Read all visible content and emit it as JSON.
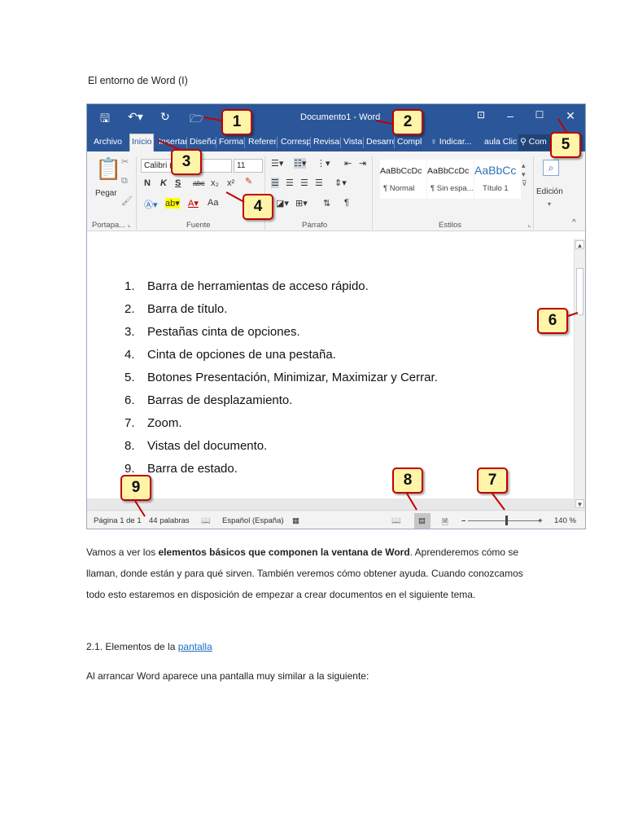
{
  "doc_heading": "El entorno de Word (I)",
  "word": {
    "title": "Documento1 - Word",
    "tabs": [
      "Archivo",
      "Inicio",
      "Insertar",
      "Diseño",
      "Format",
      "Referer",
      "Corresp",
      "Revisar",
      "Vista",
      "Desarro",
      "Compl"
    ],
    "tell_me": "Indicar...",
    "account_text": "aula Clic",
    "share_text": "Com",
    "ribbon": {
      "paste_label": "Pegar",
      "font_name": "Calibri (",
      "font_size": "11",
      "bold": "N",
      "italic": "K",
      "underline": "S",
      "strike": "abc",
      "sub": "x₂",
      "sup": "x²",
      "case": "Aa",
      "pilcrow": "¶",
      "styles": [
        {
          "sample": "AaBbCcDc",
          "name": "¶ Normal"
        },
        {
          "sample": "AaBbCcDc",
          "name": "¶ Sin espa..."
        },
        {
          "sample": "AaBbCc",
          "name": "Título 1"
        }
      ],
      "edit_label": "Edición",
      "groups": [
        "Portapa...",
        "Fuente",
        "Párrafo",
        "Estilos"
      ]
    },
    "list_items": [
      {
        "num": "1.",
        "text": "Barra de herramientas de acceso rápido."
      },
      {
        "num": "2.",
        "text": "Barra de título."
      },
      {
        "num": "3.",
        "text": "Pestañas cinta de opciones."
      },
      {
        "num": "4.",
        "text": "Cinta de opciones de una pestaña."
      },
      {
        "num": "5.",
        "text": "Botones  Presentación, Minimizar, Maximizar y Cerrar."
      },
      {
        "num": "6.",
        "text": "Barras de desplazamiento."
      },
      {
        "num": "7.",
        "text": "Zoom."
      },
      {
        "num": "8.",
        "text": "Vistas del documento."
      },
      {
        "num": "9.",
        "text": "Barra de estado."
      }
    ],
    "status": {
      "page": "Página 1 de 1",
      "words": "44 palabras",
      "language": "Español (España)",
      "zoom": "140 %"
    }
  },
  "callouts": [
    "1",
    "2",
    "3",
    "4",
    "5",
    "6",
    "7",
    "8",
    "9"
  ],
  "body": {
    "p1_a": "Vamos a ver los ",
    "p1_b": "elementos básicos que componen la ventana de Word",
    "p1_c": ". Aprenderemos cómo se llaman, donde están y para qué sirven. También veremos cómo obtener ayuda. Cuando conozcamos todo esto estaremos en disposición de empezar a crear documentos en el siguiente tema.",
    "section_prefix": "2.1. Elementos de la ",
    "section_link": " pantalla",
    "p2": "Al arrancar Word aparece una pantalla muy similar a la siguiente:"
  },
  "colors": {
    "word_blue": "#2b579a",
    "callout_fill": "#fff4a8",
    "callout_border": "#c00000",
    "link": "#1a6fc4"
  }
}
